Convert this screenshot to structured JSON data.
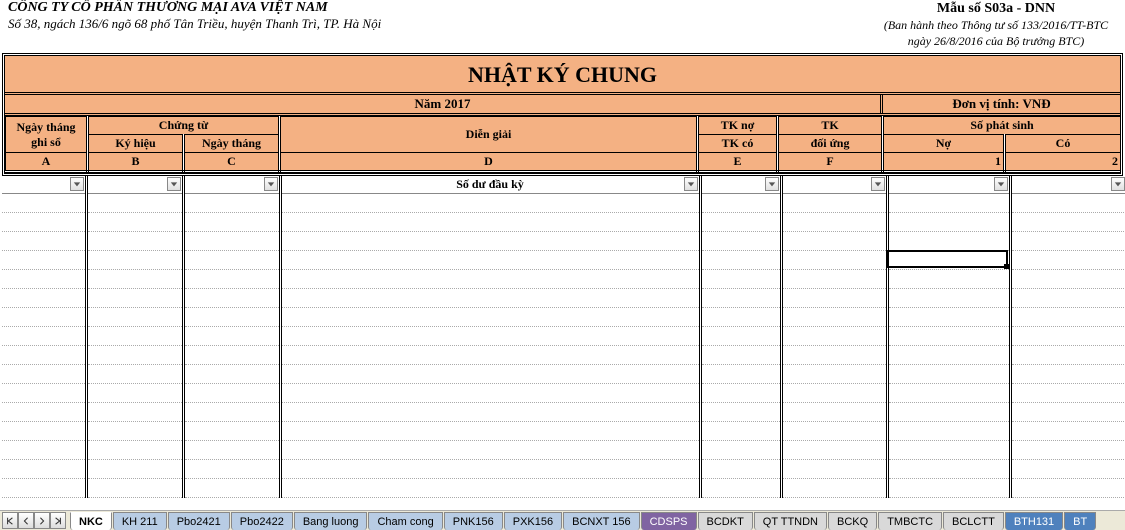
{
  "company": {
    "name": "CÔNG TY CỔ PHẦN THƯƠNG MẠI AVA VIỆT NAM",
    "address": "Số 38, ngách 136/6 ngõ 68 phố Tân Triều, huyện Thanh Trì, TP. Hà Nội"
  },
  "form_code": {
    "title": "Mẫu số S03a - DNN",
    "line1": "(Ban hành theo Thông tư số 133/2016/TT-BTC",
    "line2": "ngày 26/8/2016 của Bộ trưởng BTC)"
  },
  "title": "NHẬT KÝ CHUNG",
  "period": "Năm 2017",
  "unit_label": "Đơn vị tính: VNĐ",
  "headers": {
    "ngay_thang_ghi_so": "Ngày tháng ghi sổ",
    "chung_tu": "Chứng từ",
    "ky_hieu": "Ký hiệu",
    "ngay_thang": "Ngày tháng",
    "dien_giai": "Diễn giải",
    "tk_no": "TK nợ",
    "tk_co": "TK có",
    "tk": "TK",
    "doi_ung": "đối ứng",
    "so_phat_sinh": "Số phát sinh",
    "no": "Nợ",
    "co": "Có"
  },
  "col_letters": {
    "a": "A",
    "b": "B",
    "c": "C",
    "d": "D",
    "e": "E",
    "f": "F",
    "one": "1",
    "two": "2"
  },
  "opening_balance": "Số dư đầu kỳ",
  "tabs": [
    {
      "label": "NKC",
      "color": "#ffffff",
      "active": true
    },
    {
      "label": "KH 211",
      "color": "#b8cce4"
    },
    {
      "label": "Pbo2421",
      "color": "#b8cce4"
    },
    {
      "label": "Pbo2422",
      "color": "#b8cce4"
    },
    {
      "label": "Bang luong",
      "color": "#b8cce4"
    },
    {
      "label": "Cham cong",
      "color": "#b8cce4"
    },
    {
      "label": "PNK156",
      "color": "#b8cce4"
    },
    {
      "label": "PXK156",
      "color": "#b8cce4"
    },
    {
      "label": "BCNXT 156",
      "color": "#b8cce4"
    },
    {
      "label": "CDSPS",
      "color": "#8064a2",
      "text_color": "#fff"
    },
    {
      "label": "BCDKT",
      "color": "#d9d9d9"
    },
    {
      "label": "QT TTNDN",
      "color": "#d9d9d9"
    },
    {
      "label": "BCKQ",
      "color": "#d9d9d9"
    },
    {
      "label": "TMBCTC",
      "color": "#d9d9d9"
    },
    {
      "label": "BCLCTT",
      "color": "#d9d9d9"
    },
    {
      "label": "BTH131",
      "color": "#4f81bd",
      "text_color": "#fff"
    },
    {
      "label": "BT",
      "color": "#4f81bd",
      "text_color": "#fff"
    }
  ]
}
